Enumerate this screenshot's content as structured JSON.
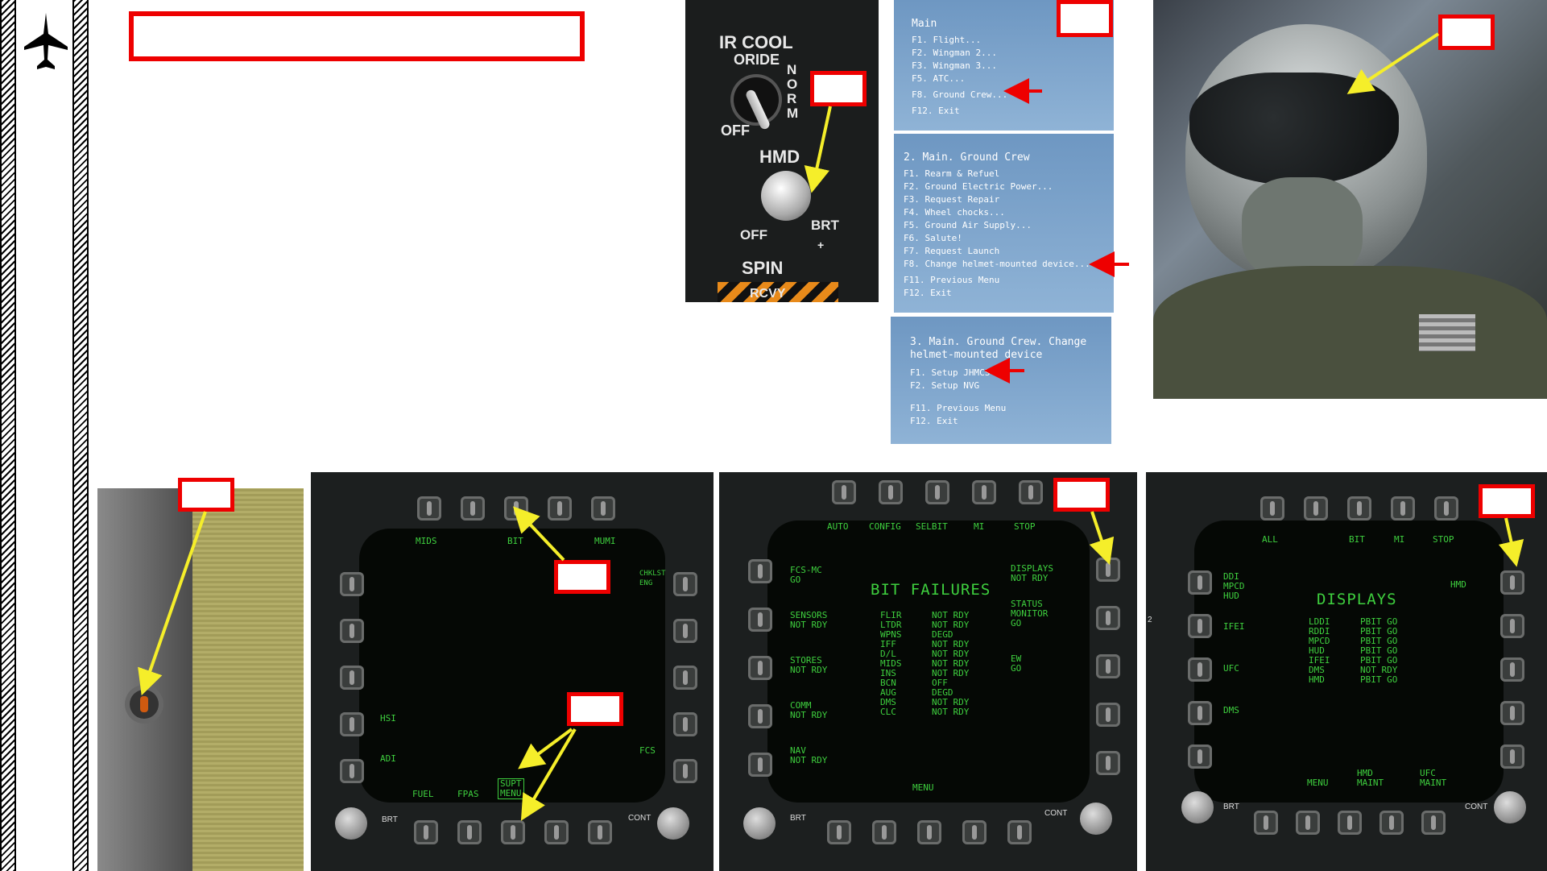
{
  "ir_panel": {
    "ir_cool_label": "IR COOL",
    "oride_label": "ORIDE",
    "norm_label": "N O R M",
    "off_label": "OFF",
    "hmd_label": "HMD",
    "hmd_off_label": "OFF",
    "brt_label": "BRT",
    "plus_label": "+",
    "spin_label": "SPIN",
    "rcvy_label": "RCVY"
  },
  "menus": {
    "main": [
      "Main",
      "F1. Flight...",
      "F2. Wingman 2...",
      "F3. Wingman 3...",
      "F5. ATC...",
      "F8. Ground Crew...",
      "F12. Exit"
    ],
    "ground_crew": [
      "2. Main. Ground Crew",
      "F1. Rearm & Refuel",
      "F2. Ground Electric Power...",
      "F3. Request Repair",
      "F4. Wheel chocks...",
      "F5. Ground Air Supply...",
      "F6. Salute!",
      "F7. Request Launch",
      "F8. Change helmet-mounted device...",
      "F11. Previous Menu",
      "F12. Exit"
    ],
    "hmd_device": [
      "3. Main. Ground Crew. Change",
      "helmet-mounted device",
      "F1. Setup JHMCS",
      "F2. Setup NVG",
      "F11. Previous Menu",
      "F12. Exit"
    ]
  },
  "ddi1": {
    "top": [
      "MIDS",
      "BIT",
      "MUMI"
    ],
    "right": "CHKLST ENG",
    "left": [
      "HSI",
      "ADI"
    ],
    "bottom": [
      "FUEL",
      "FPAS",
      "SUPT\nMENU"
    ],
    "right_bottom": "FCS",
    "brt": "BRT",
    "cont": "CONT"
  },
  "ddi2": {
    "top": [
      "AUTO",
      "CONFIG",
      "SELBIT",
      "MI",
      "STOP"
    ],
    "title": "BIT FAILURES",
    "left": [
      "FCS-MC\nGO",
      "SENSORS\nNOT RDY",
      "STORES\nNOT RDY",
      "COMM\nNOT RDY",
      "NAV\nNOT RDY"
    ],
    "right": [
      "DISPLAYS\nNOT RDY",
      "STATUS\nMONITOR\nGO",
      "EW\nGO"
    ],
    "list_names": "FLIR\nLTDR\nWPNS\nIFF\nD/L\nMIDS\nINS\nBCN\nAUG\nDMS\nCLC",
    "list_status": "NOT RDY\nNOT RDY\nDEGD\nNOT RDY\nNOT RDY\nNOT RDY\nNOT RDY\nOFF\nDEGD\nNOT RDY\nNOT RDY",
    "bottom": "MENU",
    "brt": "BRT",
    "cont": "CONT"
  },
  "ddi3": {
    "top": [
      "ALL",
      "BIT",
      "MI",
      "STOP"
    ],
    "title": "DISPLAYS",
    "left": [
      "DDI\nMPCD\nHUD",
      "IFEI",
      "UFC",
      "DMS"
    ],
    "right": "HMD",
    "list_names": "LDDI\nRDDI\nMPCD\nHUD\nIFEI\nDMS\nHMD",
    "list_status": "PBIT GO\nPBIT GO\nPBIT GO\nPBIT GO\nPBIT GO\nNOT RDY\nPBIT GO",
    "bottom": [
      "MENU",
      "HMD\nMAINT",
      "UFC\nMAINT"
    ],
    "side_num": "2",
    "brt": "BRT",
    "cont": "CONT"
  },
  "colors": {
    "callout": "#e00000",
    "arrow_yellow": "#f5ee2a",
    "arrow_red": "#e00000",
    "mfd_green": "#3ecf3e"
  }
}
